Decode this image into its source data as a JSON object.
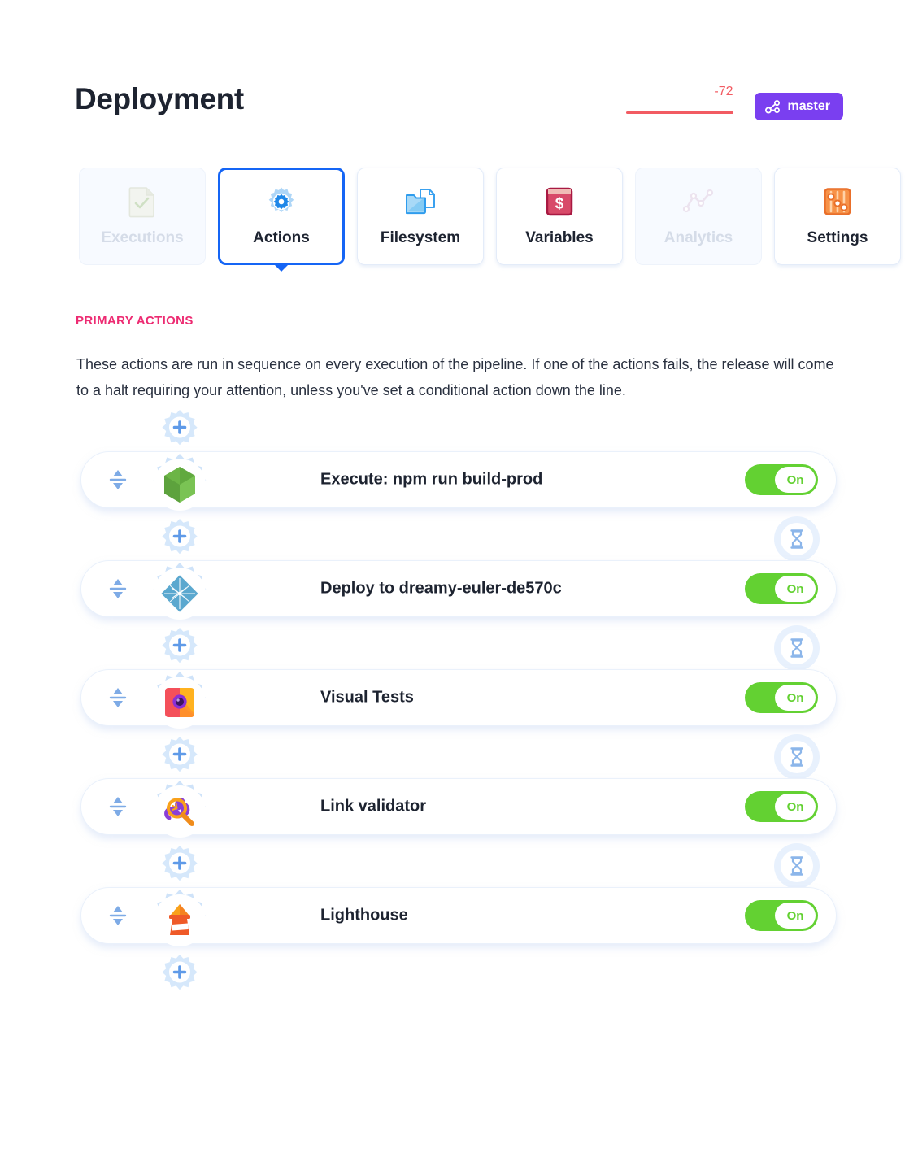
{
  "header": {
    "title": "Deployment",
    "trend_value": "-72",
    "trend_color": "#f25b62",
    "branch": "master",
    "branch_color": "#7a3ff0",
    "branch_icon": "branch-icon"
  },
  "tabs": [
    {
      "label": "Executions",
      "icon": "document-check-icon",
      "state": "disabled"
    },
    {
      "label": "Actions",
      "icon": "gear-icon",
      "state": "active"
    },
    {
      "label": "Filesystem",
      "icon": "folder-files-icon",
      "state": "default"
    },
    {
      "label": "Variables",
      "icon": "dollar-window-icon",
      "state": "default"
    },
    {
      "label": "Analytics",
      "icon": "line-chart-icon",
      "state": "disabled"
    },
    {
      "label": "Settings",
      "icon": "sliders-icon",
      "state": "default"
    }
  ],
  "section": {
    "label": "PRIMARY ACTIONS",
    "label_color": "#ed2b72",
    "description": "These actions are run in sequence on every execution of the pipeline. If one of the actions fails, the release will come to a halt requiring your attention, unless you've set a conditional action down the line."
  },
  "pipeline": {
    "add_icon": "gear-plus-icon",
    "wait_icon": "hourglass-icon",
    "drag_icon": "drag-handle-icon",
    "toggle_on_label": "On",
    "toggle_on_color": "#63d132",
    "actions": [
      {
        "label": "Execute: npm run build-prod",
        "icon": "nodejs-hexagon-icon",
        "toggle": "On"
      },
      {
        "label": "Deploy to dreamy-euler-de570c",
        "icon": "netlify-diamond-icon",
        "toggle": "On"
      },
      {
        "label": "Visual Tests",
        "icon": "percy-camera-icon",
        "toggle": "On"
      },
      {
        "label": "Link validator",
        "icon": "magnifier-links-icon",
        "toggle": "On"
      },
      {
        "label": "Lighthouse",
        "icon": "lighthouse-icon",
        "toggle": "On"
      }
    ]
  }
}
